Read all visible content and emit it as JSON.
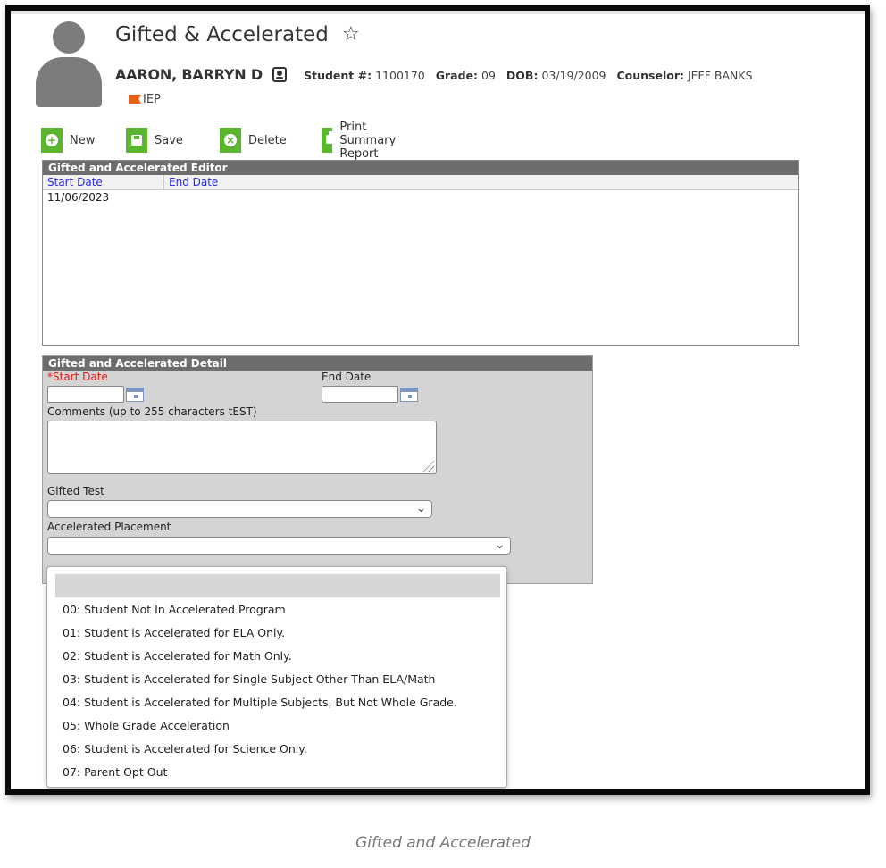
{
  "header": {
    "title": "Gifted & Accelerated",
    "student_name": "AARON, BARRYN D",
    "student_number_label": "Student #:",
    "student_number": "1100170",
    "grade_label": "Grade:",
    "grade": "09",
    "dob_label": "DOB:",
    "dob": "03/19/2009",
    "counselor_label": "Counselor:",
    "counselor": "JEFF BANKS",
    "flag_text": "IEP"
  },
  "toolbar": {
    "new_label": "New",
    "save_label": "Save",
    "delete_label": "Delete",
    "print_label": "Print Summary Report"
  },
  "editor": {
    "title": "Gifted and Accelerated Editor",
    "col_start": "Start Date",
    "col_end": "End Date",
    "rows": [
      {
        "start": "11/06/2023",
        "end": ""
      }
    ]
  },
  "detail": {
    "title": "Gifted and Accelerated Detail",
    "start_date_label": "*Start Date",
    "end_date_label": "End Date",
    "start_date_value": "",
    "end_date_value": "",
    "comments_label": "Comments (up to 255 characters tEST)",
    "comments_value": "",
    "gifted_test_label": "Gifted Test",
    "gifted_test_value": "",
    "accelerated_label": "Accelerated Placement",
    "accelerated_value": ""
  },
  "dropdown": {
    "options": [
      "",
      "00: Student Not In Accelerated Program",
      "01: Student is Accelerated for ELA Only.",
      "02: Student is Accelerated for Math Only.",
      "03: Student is Accelerated for Single Subject Other Than ELA/Math",
      "04: Student is Accelerated for Multiple Subjects, But Not Whole Grade.",
      "05: Whole Grade Acceleration",
      "06: Student is Accelerated for Science Only.",
      "07: Parent Opt Out"
    ]
  },
  "caption": "Gifted and Accelerated",
  "colors": {
    "toolbar_green": "#5cb52f",
    "panel_header": "#6d6d6d",
    "required_red": "#e01b1b",
    "column_link_blue": "#2a2ae0",
    "flag_orange": "#e8611a"
  },
  "icons": [
    "star-icon",
    "contact-card-icon",
    "flag-icon",
    "plus-icon",
    "save-icon",
    "delete-icon",
    "print-icon",
    "calendar-icon",
    "chevron-down-icon"
  ]
}
